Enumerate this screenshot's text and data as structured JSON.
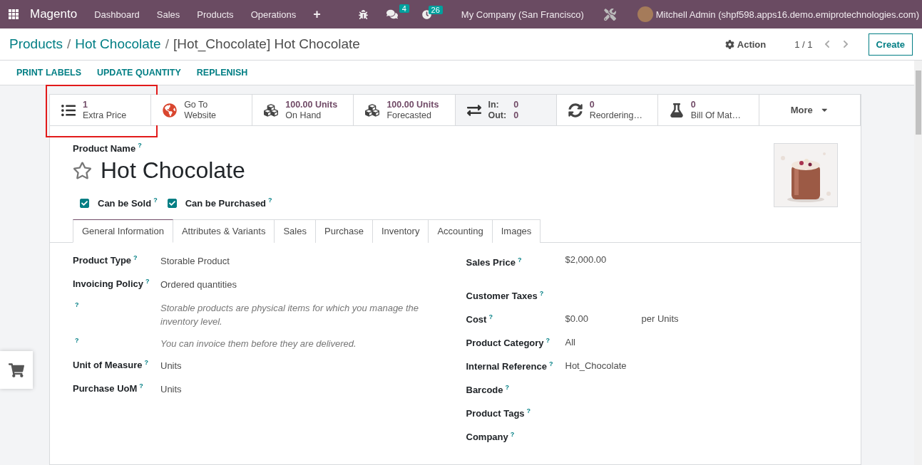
{
  "navbar": {
    "app": "Magento",
    "menu": [
      "Dashboard",
      "Sales",
      "Products",
      "Operations"
    ],
    "add": "+",
    "messages_count": "4",
    "activities_count": "26",
    "company": "My Company (San Francisco)",
    "user": "Mitchell Admin (shpf598.apps16.demo.emiprotechnologies.com)"
  },
  "breadcrumb": [
    {
      "label": "Products",
      "link": true
    },
    {
      "label": "Hot Chocolate",
      "link": true
    },
    {
      "label": "[Hot_Chocolate] Hot Chocolate",
      "link": false
    }
  ],
  "breadcrumb_separators": [
    "/",
    "/"
  ],
  "action": "Action",
  "pager": "1 / 1",
  "create": "Create",
  "header_buttons": [
    "PRINT LABELS",
    "UPDATE QUANTITY",
    "REPLENISH"
  ],
  "stat_buttons": [
    {
      "kind": "list",
      "value": "1",
      "label": "Extra Price",
      "highlighted": true
    },
    {
      "kind": "globe",
      "value": "Go To",
      "label": "Website",
      "highlighted": false
    },
    {
      "kind": "cubes",
      "value": "100.00 Units",
      "label": "On Hand",
      "highlighted": false
    },
    {
      "kind": "cubes",
      "value": "100.00 Units",
      "label": "Forecasted",
      "highlighted": false
    },
    {
      "kind": "inout",
      "in_label": "In:",
      "in_value": "0",
      "out_label": "Out:",
      "out_value": "0",
      "highlighted": false
    },
    {
      "kind": "sync",
      "value": "0",
      "label": "Reordering…",
      "highlighted": false
    },
    {
      "kind": "flask",
      "value": "0",
      "label": "Bill Of Mat…",
      "highlighted": false
    },
    {
      "kind": "more",
      "label": "More",
      "highlighted": false
    }
  ],
  "product": {
    "name_label": "Product Name",
    "help": "?",
    "name": "Hot Chocolate",
    "favorite": false,
    "flags": [
      {
        "label": "Can be Sold",
        "help": "?",
        "checked": true
      },
      {
        "label": "Can be Purchased",
        "help": "?",
        "checked": true
      }
    ]
  },
  "tabs": [
    {
      "label": "General Information",
      "selected": true
    },
    {
      "label": "Attributes & Variants",
      "selected": false
    },
    {
      "label": "Sales",
      "selected": false
    },
    {
      "label": "Purchase",
      "selected": false
    },
    {
      "label": "Inventory",
      "selected": false
    },
    {
      "label": "Accounting",
      "selected": false
    },
    {
      "label": "Images",
      "selected": false
    }
  ],
  "left_fields": [
    {
      "kind": "field",
      "label": "Product Type",
      "help": "?",
      "value": "Storable Product"
    },
    {
      "kind": "field",
      "label": "Invoicing Policy",
      "help": "?",
      "value": "Ordered quantities"
    },
    {
      "kind": "note",
      "help": "?",
      "value": "Storable products are physical items for which you manage the inventory level."
    },
    {
      "kind": "note",
      "help": "?",
      "value": "You can invoice them before they are delivered."
    },
    {
      "kind": "field",
      "label": "Unit of Measure",
      "help": "?",
      "value": "Units"
    },
    {
      "kind": "field",
      "label": "Purchase UoM",
      "help": "?",
      "value": "Units"
    }
  ],
  "right_fields": [
    {
      "label": "Sales Price",
      "help": "?",
      "value": "$2,000.00"
    },
    {
      "label": "Customer Taxes",
      "help": "?"
    },
    {
      "label": "Cost",
      "help": "?",
      "value": "$0.00",
      "suffix": "per Units"
    },
    {
      "label": "Product Category",
      "help": "?",
      "value": "All"
    },
    {
      "label": "Internal Reference",
      "help": "?",
      "value": "Hot_Chocolate"
    },
    {
      "label": "Barcode",
      "help": "?"
    },
    {
      "label": "Product Tags",
      "help": "?"
    },
    {
      "label": "Company",
      "help": "?"
    }
  ]
}
